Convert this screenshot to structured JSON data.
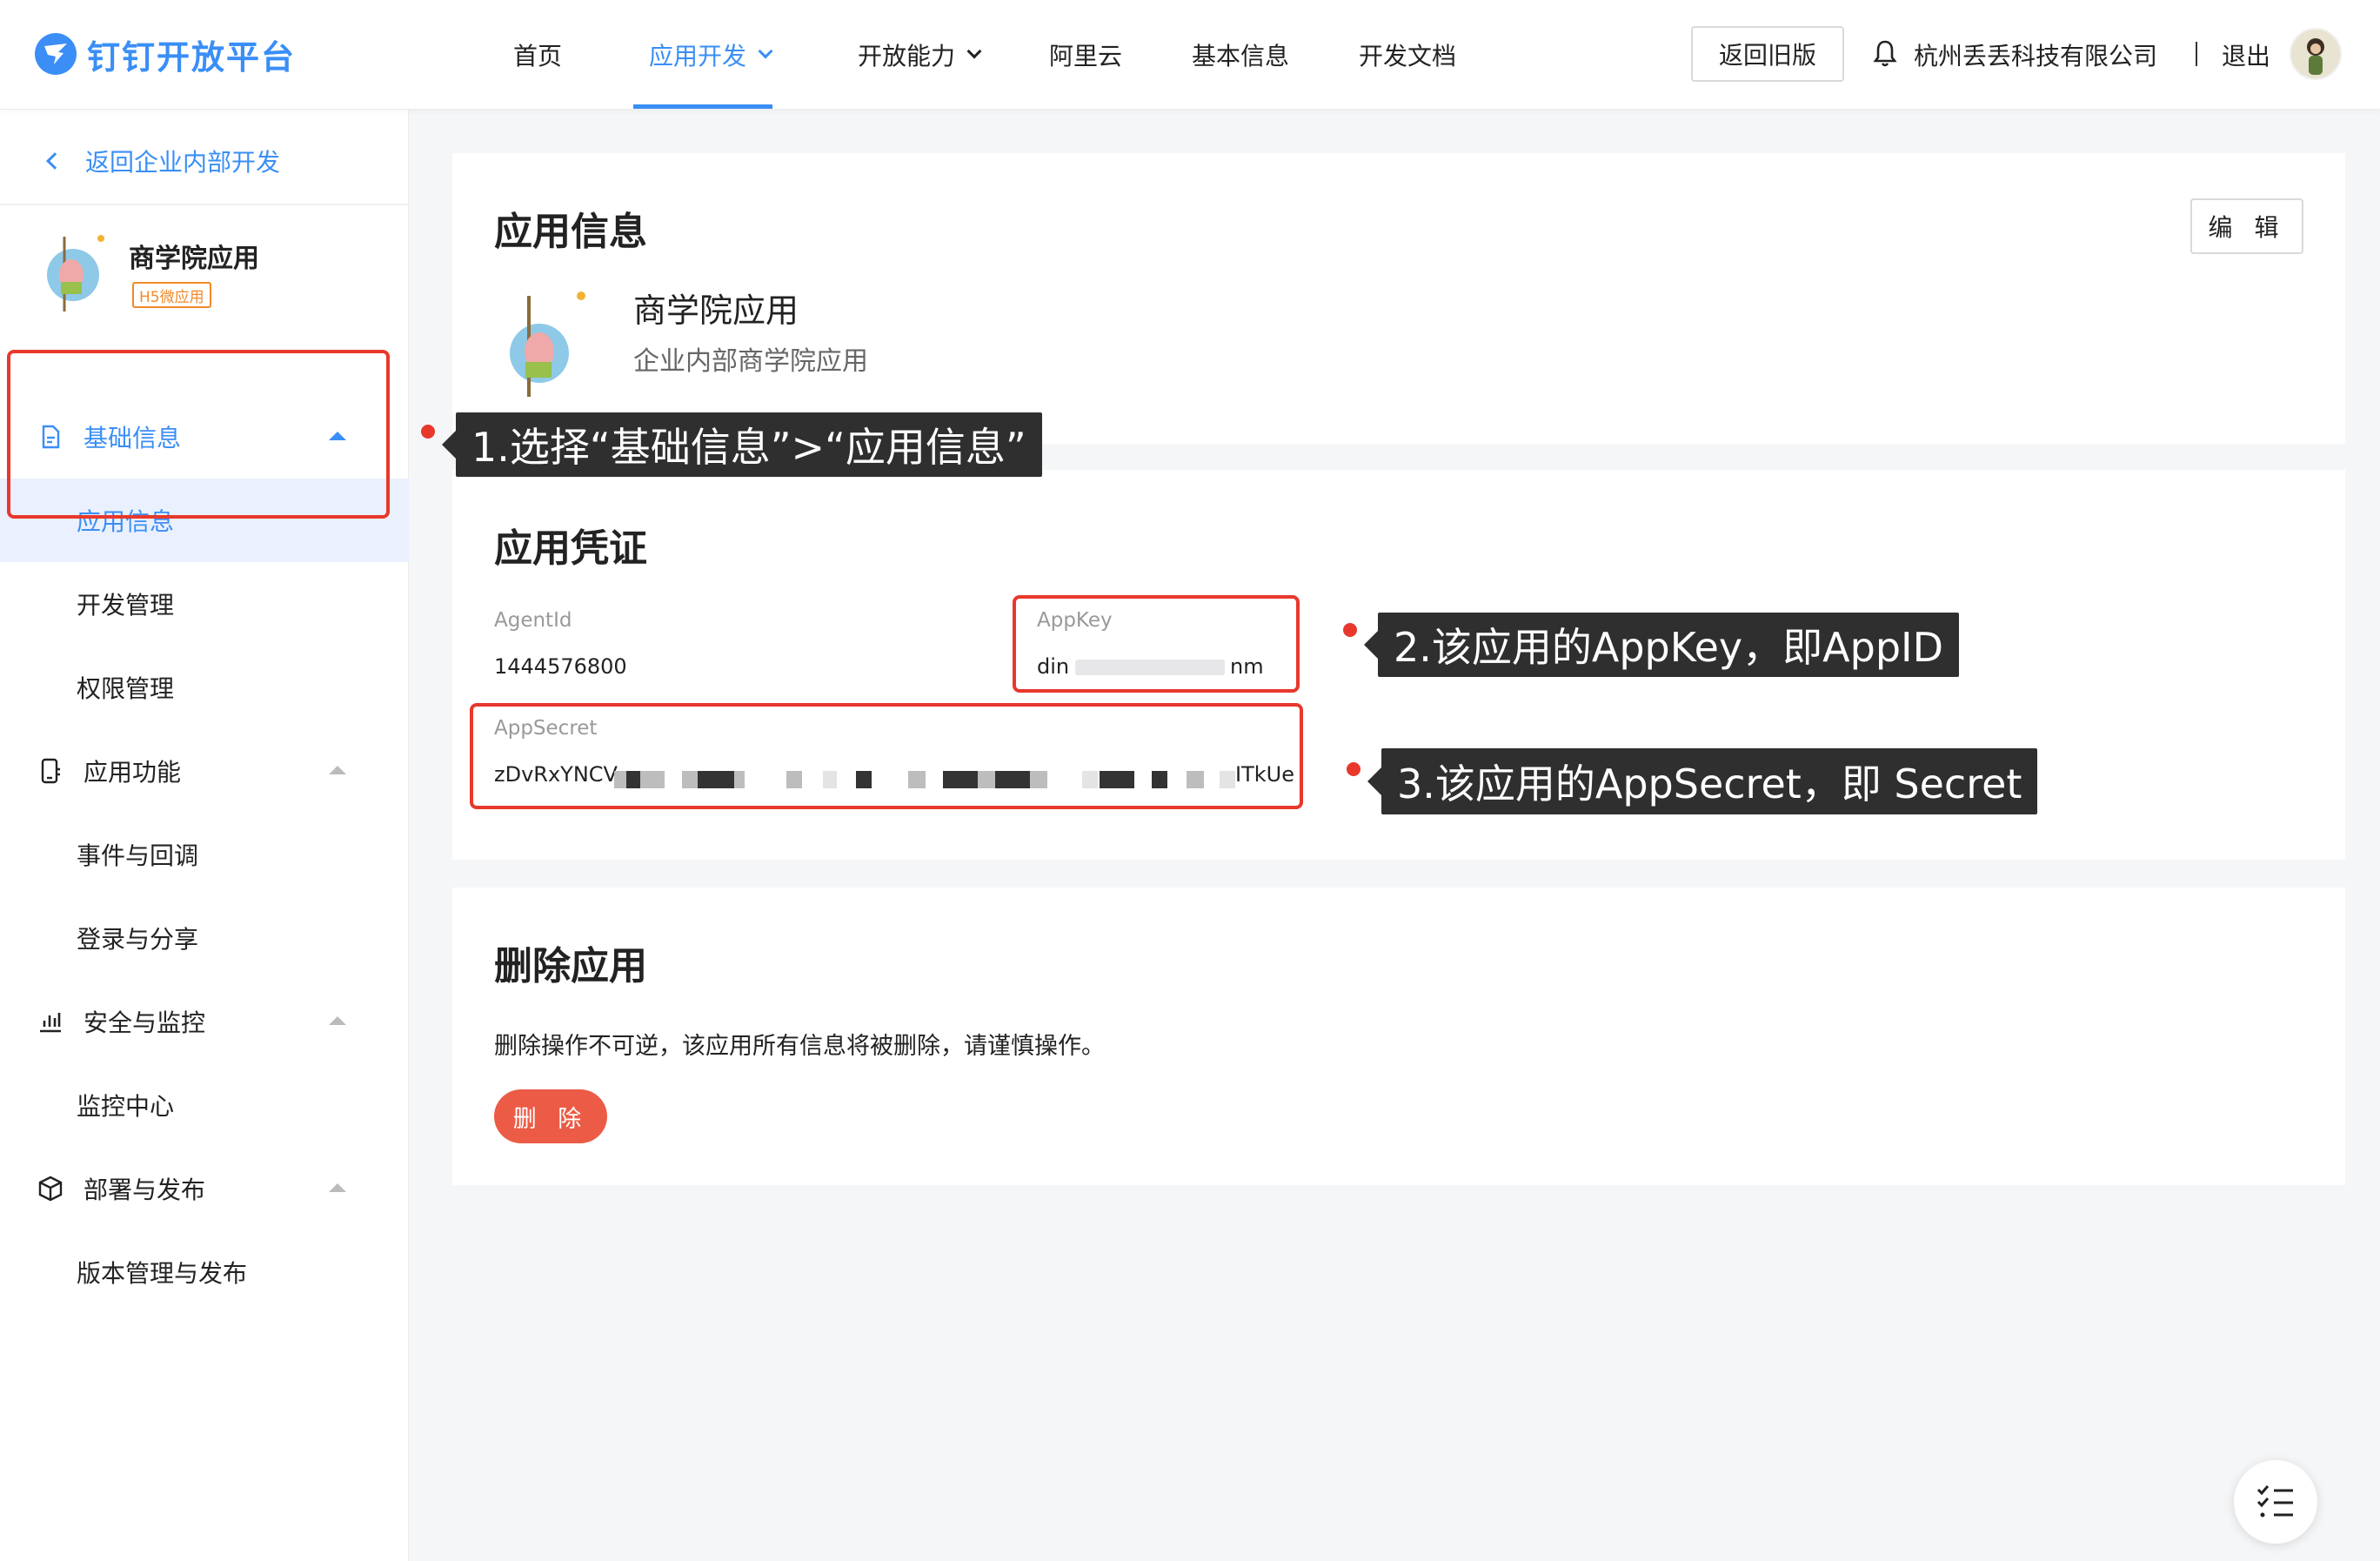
{
  "brand": {
    "name": "钉钉开放平台",
    "accent": "#3a8ef6"
  },
  "nav": {
    "home": "首页",
    "app_dev": "应用开发",
    "capabilities": "开放能力",
    "aliyun": "阿里云",
    "basic_info": "基本信息",
    "docs": "开发文档",
    "old_version": "返回旧版",
    "company": "杭州丢丢科技有限公司",
    "logout": "退出"
  },
  "sidebar": {
    "back": "返回企业内部开发",
    "app_name": "商学院应用",
    "app_type": "H5微应用",
    "groups": [
      {
        "label": "基础信息",
        "icon": "file-icon",
        "children": [
          "应用信息",
          "开发管理",
          "权限管理"
        ]
      },
      {
        "label": "应用功能",
        "icon": "phone-icon",
        "children": [
          "事件与回调",
          "登录与分享"
        ]
      },
      {
        "label": "安全与监控",
        "icon": "bar-chart-icon",
        "children": [
          "监控中心"
        ]
      },
      {
        "label": "部署与发布",
        "icon": "cube-icon",
        "children": [
          "版本管理与发布"
        ]
      }
    ],
    "selected": "应用信息"
  },
  "app_info": {
    "title": "应用信息",
    "edit": "编 辑",
    "name": "商学院应用",
    "desc": "企业内部商学院应用"
  },
  "credentials": {
    "title": "应用凭证",
    "agent_id_label": "AgentId",
    "agent_id": "1444576800",
    "app_key_label": "AppKey",
    "app_key_prefix": "din",
    "app_key_suffix": "nm",
    "app_secret_label": "AppSecret",
    "app_secret_prefix": "zDvRxYNCV",
    "app_secret_suffix": "ITkUe"
  },
  "delete": {
    "title": "删除应用",
    "text": "删除操作不可逆，该应用所有信息将被删除，请谨慎操作。",
    "button": "删 除",
    "button_color": "#ec5b45"
  },
  "annotations": [
    "1.选择“基础信息”>“应用信息”",
    "2.该应用的AppKey，即AppID",
    "3.该应用的AppSecret，即 Secret"
  ],
  "annotation_color": "#e8382c"
}
